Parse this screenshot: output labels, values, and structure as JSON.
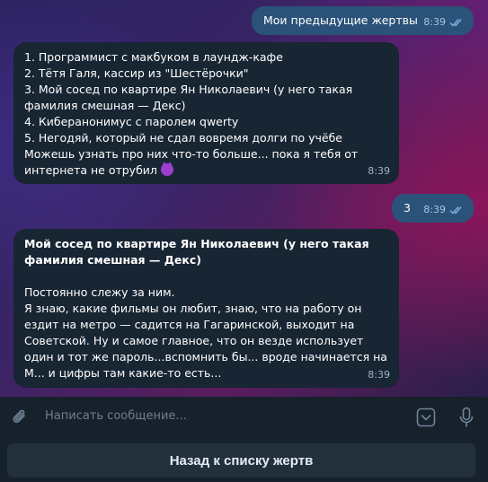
{
  "messages": [
    {
      "direction": "out",
      "text": "Мои предыдущие жертвы",
      "time": "8:39"
    },
    {
      "direction": "in",
      "text": "1. Программист с макбуком в лаундж-кафе\n2. Тётя Галя, кассир из \"Шестёрочки\"\n3. Мой сосед по квартире Ян Николаевич (у него такая фамилия смешная — Декс)\n4. Киберанонимус с паролем qwerty\n5. Негодяй, который не сдал вовремя долги по учёбе\nМожешь узнать про них что-то больше... пока я тебя от интернета не отрубил",
      "emoji": "smiling-imp",
      "time": "8:39"
    },
    {
      "direction": "out",
      "text": "3",
      "time": "8:39"
    },
    {
      "direction": "in",
      "title": "Мой сосед по квартире Ян Николаевич (у него такая фамилия смешная — Декс)",
      "text": "Постоянно слежу за ним.\nЯ знаю, какие фильмы он любит, знаю, что на работу он ездит на метро — садится на Гагаринской, выходит на Советской. Ну и самое главное, что он везде использует один и тот же пароль...вспомнить бы... вроде начинается на М... и цифры там какие-то есть...",
      "time": "8:39"
    }
  ],
  "input": {
    "placeholder": "Написать сообщение..."
  },
  "icons": {
    "attach": "paperclip-icon",
    "commands": "bot-command-icon",
    "voice": "microphone-icon",
    "read": "double-check-icon"
  },
  "keyboard": {
    "button_label": "Назад к списку жертв"
  },
  "colors": {
    "outgoing_bubble": "#2b5278",
    "incoming_bubble": "#182533",
    "input_bar": "#17212b",
    "keyboard_button": "#22303c"
  }
}
